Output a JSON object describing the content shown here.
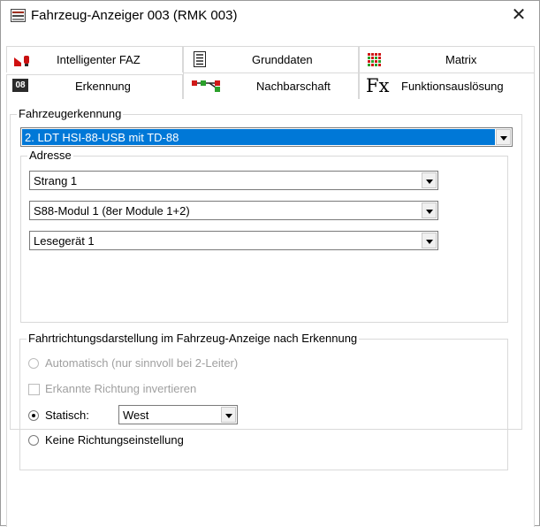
{
  "window": {
    "title": "Fahrzeug-Anzeiger 003 (RMK 003)",
    "close_glyph": "✕",
    "icon": "wdp-app-icon"
  },
  "tabs": {
    "row1": [
      {
        "label": "Intelligenter FAZ",
        "icon": "red-signal-icon"
      },
      {
        "label": "Grunddaten",
        "icon": "document-lines-icon"
      },
      {
        "label": "Matrix",
        "icon": "matrix-grid-icon"
      }
    ],
    "row2": [
      {
        "label": "Erkennung",
        "icon": "08-badge-icon",
        "badge": "08",
        "active": true
      },
      {
        "label": "Nachbarschaft",
        "icon": "network-nodes-icon"
      },
      {
        "label": "Funktionsauslösung",
        "icon": "fx-function-icon",
        "fx": "Fx"
      }
    ]
  },
  "erkennung": {
    "legend": "Fahrzeugerkennung",
    "device": "2. LDT HSI-88-USB mit TD-88"
  },
  "adresse": {
    "legend": "Adresse",
    "strang": "Strang 1",
    "modul": "S88-Modul 1 (8er Module 1+2)",
    "lesegeraet": "Lesegerät 1"
  },
  "fahrtrichtung": {
    "legend": "Fahrtrichtungsdarstellung  im Fahrzeug-Anzeige nach Erkennung",
    "automatisch": "Automatisch (nur sinnvoll bei 2-Leiter)",
    "invertieren": "Erkannte Richtung invertieren",
    "statisch": "Statisch:",
    "statisch_value": "West",
    "keine": "Keine Richtungseinstellung"
  },
  "colors": {
    "selection": "#0078d7",
    "disabled_text": "#a0a0a0",
    "border": "#d9d9d9"
  }
}
